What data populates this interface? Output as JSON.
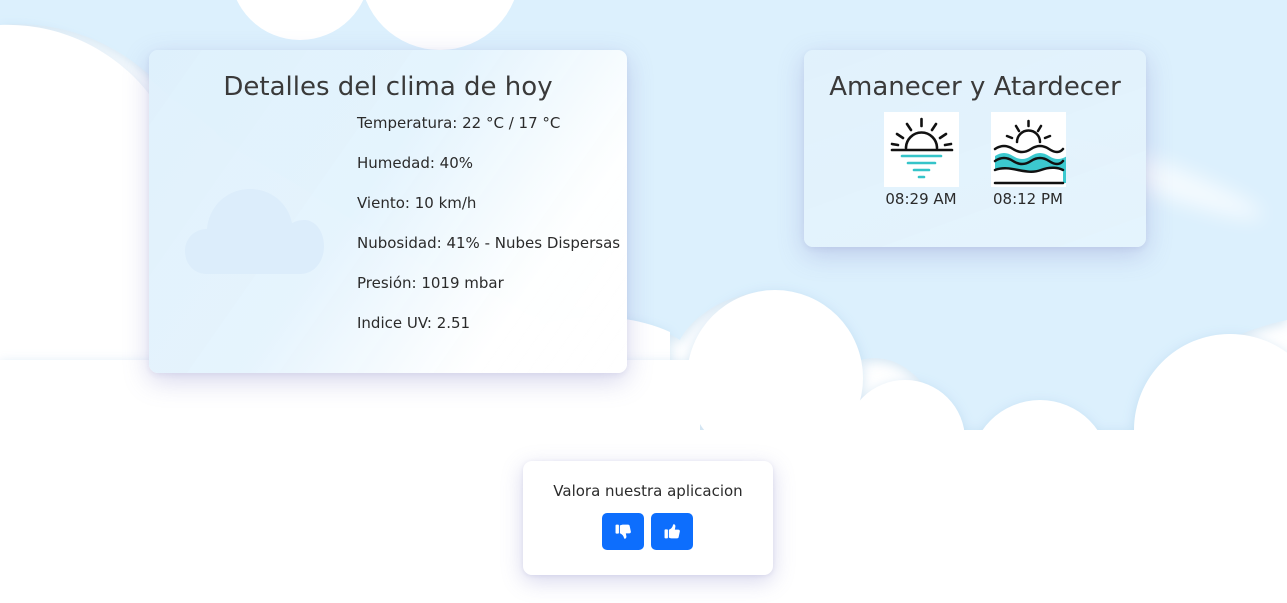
{
  "weather": {
    "title": "Detalles del clima de hoy",
    "icon": "cloud-icon",
    "details": [
      "Temperatura: 22 °C / 17 °C",
      "Humedad: 40%",
      "Viento: 10 km/h",
      "Nubosidad: 41% - Nubes Dispersas",
      "Presión: 1019 mbar",
      "Indice UV: 2.51"
    ]
  },
  "sun": {
    "title": "Amanecer y Atardecer",
    "sunrise": {
      "icon": "sunrise-icon",
      "time": "08:29 AM"
    },
    "sunset": {
      "icon": "sunset-icon",
      "time": "08:12 PM"
    }
  },
  "rating": {
    "title": "Valora nuestra aplicacion",
    "dislike_icon": "thumbs-down-icon",
    "like_icon": "thumbs-up-icon"
  },
  "colors": {
    "accent_button": "#0d6efd",
    "sky": "#dcf0fd",
    "text": "#3a3a3a",
    "cloud_icon": "#dcedfb",
    "sunrise_water": "#35c4c9"
  }
}
